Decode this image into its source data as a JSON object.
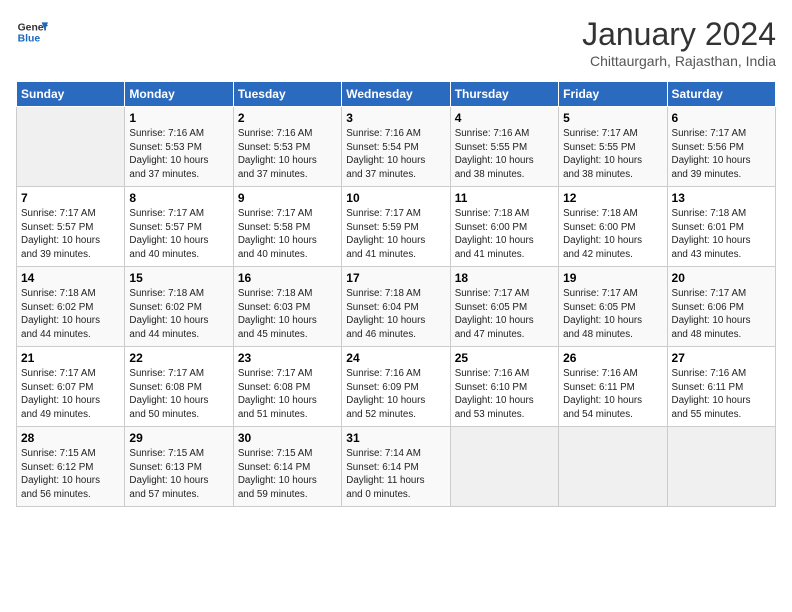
{
  "header": {
    "logo_line1": "General",
    "logo_line2": "Blue",
    "month": "January 2024",
    "location": "Chittaurgarh, Rajasthan, India"
  },
  "days_of_week": [
    "Sunday",
    "Monday",
    "Tuesday",
    "Wednesday",
    "Thursday",
    "Friday",
    "Saturday"
  ],
  "weeks": [
    [
      {
        "day": "",
        "info": ""
      },
      {
        "day": "1",
        "info": "Sunrise: 7:16 AM\nSunset: 5:53 PM\nDaylight: 10 hours\nand 37 minutes."
      },
      {
        "day": "2",
        "info": "Sunrise: 7:16 AM\nSunset: 5:53 PM\nDaylight: 10 hours\nand 37 minutes."
      },
      {
        "day": "3",
        "info": "Sunrise: 7:16 AM\nSunset: 5:54 PM\nDaylight: 10 hours\nand 37 minutes."
      },
      {
        "day": "4",
        "info": "Sunrise: 7:16 AM\nSunset: 5:55 PM\nDaylight: 10 hours\nand 38 minutes."
      },
      {
        "day": "5",
        "info": "Sunrise: 7:17 AM\nSunset: 5:55 PM\nDaylight: 10 hours\nand 38 minutes."
      },
      {
        "day": "6",
        "info": "Sunrise: 7:17 AM\nSunset: 5:56 PM\nDaylight: 10 hours\nand 39 minutes."
      }
    ],
    [
      {
        "day": "7",
        "info": "Sunrise: 7:17 AM\nSunset: 5:57 PM\nDaylight: 10 hours\nand 39 minutes."
      },
      {
        "day": "8",
        "info": "Sunrise: 7:17 AM\nSunset: 5:57 PM\nDaylight: 10 hours\nand 40 minutes."
      },
      {
        "day": "9",
        "info": "Sunrise: 7:17 AM\nSunset: 5:58 PM\nDaylight: 10 hours\nand 40 minutes."
      },
      {
        "day": "10",
        "info": "Sunrise: 7:17 AM\nSunset: 5:59 PM\nDaylight: 10 hours\nand 41 minutes."
      },
      {
        "day": "11",
        "info": "Sunrise: 7:18 AM\nSunset: 6:00 PM\nDaylight: 10 hours\nand 41 minutes."
      },
      {
        "day": "12",
        "info": "Sunrise: 7:18 AM\nSunset: 6:00 PM\nDaylight: 10 hours\nand 42 minutes."
      },
      {
        "day": "13",
        "info": "Sunrise: 7:18 AM\nSunset: 6:01 PM\nDaylight: 10 hours\nand 43 minutes."
      }
    ],
    [
      {
        "day": "14",
        "info": "Sunrise: 7:18 AM\nSunset: 6:02 PM\nDaylight: 10 hours\nand 44 minutes."
      },
      {
        "day": "15",
        "info": "Sunrise: 7:18 AM\nSunset: 6:02 PM\nDaylight: 10 hours\nand 44 minutes."
      },
      {
        "day": "16",
        "info": "Sunrise: 7:18 AM\nSunset: 6:03 PM\nDaylight: 10 hours\nand 45 minutes."
      },
      {
        "day": "17",
        "info": "Sunrise: 7:18 AM\nSunset: 6:04 PM\nDaylight: 10 hours\nand 46 minutes."
      },
      {
        "day": "18",
        "info": "Sunrise: 7:17 AM\nSunset: 6:05 PM\nDaylight: 10 hours\nand 47 minutes."
      },
      {
        "day": "19",
        "info": "Sunrise: 7:17 AM\nSunset: 6:05 PM\nDaylight: 10 hours\nand 48 minutes."
      },
      {
        "day": "20",
        "info": "Sunrise: 7:17 AM\nSunset: 6:06 PM\nDaylight: 10 hours\nand 48 minutes."
      }
    ],
    [
      {
        "day": "21",
        "info": "Sunrise: 7:17 AM\nSunset: 6:07 PM\nDaylight: 10 hours\nand 49 minutes."
      },
      {
        "day": "22",
        "info": "Sunrise: 7:17 AM\nSunset: 6:08 PM\nDaylight: 10 hours\nand 50 minutes."
      },
      {
        "day": "23",
        "info": "Sunrise: 7:17 AM\nSunset: 6:08 PM\nDaylight: 10 hours\nand 51 minutes."
      },
      {
        "day": "24",
        "info": "Sunrise: 7:16 AM\nSunset: 6:09 PM\nDaylight: 10 hours\nand 52 minutes."
      },
      {
        "day": "25",
        "info": "Sunrise: 7:16 AM\nSunset: 6:10 PM\nDaylight: 10 hours\nand 53 minutes."
      },
      {
        "day": "26",
        "info": "Sunrise: 7:16 AM\nSunset: 6:11 PM\nDaylight: 10 hours\nand 54 minutes."
      },
      {
        "day": "27",
        "info": "Sunrise: 7:16 AM\nSunset: 6:11 PM\nDaylight: 10 hours\nand 55 minutes."
      }
    ],
    [
      {
        "day": "28",
        "info": "Sunrise: 7:15 AM\nSunset: 6:12 PM\nDaylight: 10 hours\nand 56 minutes."
      },
      {
        "day": "29",
        "info": "Sunrise: 7:15 AM\nSunset: 6:13 PM\nDaylight: 10 hours\nand 57 minutes."
      },
      {
        "day": "30",
        "info": "Sunrise: 7:15 AM\nSunset: 6:14 PM\nDaylight: 10 hours\nand 59 minutes."
      },
      {
        "day": "31",
        "info": "Sunrise: 7:14 AM\nSunset: 6:14 PM\nDaylight: 11 hours\nand 0 minutes."
      },
      {
        "day": "",
        "info": ""
      },
      {
        "day": "",
        "info": ""
      },
      {
        "day": "",
        "info": ""
      }
    ]
  ]
}
